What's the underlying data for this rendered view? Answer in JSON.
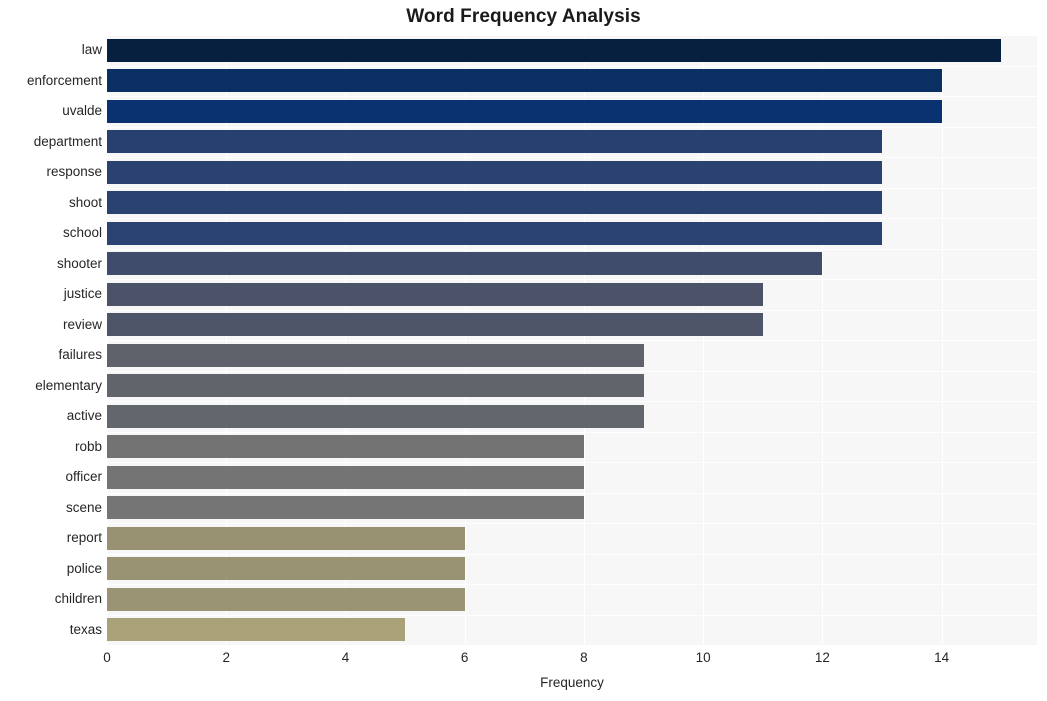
{
  "chart_data": {
    "type": "bar",
    "orientation": "horizontal",
    "title": "Word Frequency Analysis",
    "xlabel": "Frequency",
    "ylabel": "",
    "xlim": [
      0,
      15.6
    ],
    "ylim": [
      0,
      20
    ],
    "xticks": [
      0,
      2,
      4,
      6,
      8,
      10,
      12,
      14
    ],
    "xticklabels": [
      "0",
      "2",
      "4",
      "6",
      "8",
      "10",
      "12",
      "14"
    ],
    "grid": true,
    "grid_color": "#ffffff",
    "plot_background": "#f7f7f7",
    "figure_background": "#ffffff",
    "legend": null,
    "categories": [
      "law",
      "enforcement",
      "uvalde",
      "department",
      "response",
      "shoot",
      "school",
      "shooter",
      "justice",
      "review",
      "failures",
      "elementary",
      "active",
      "robb",
      "officer",
      "scene",
      "report",
      "police",
      "children",
      "texas"
    ],
    "values": [
      15,
      14,
      14,
      13,
      13,
      13,
      13,
      12,
      11,
      11,
      9,
      9,
      9,
      8,
      8,
      8,
      6,
      6,
      6,
      5
    ],
    "bar_colors": [
      "#07203f",
      "#0a2f62",
      "#0a3270",
      "#28406f",
      "#2b4270",
      "#2a4270",
      "#2b4372",
      "#3f4c6b",
      "#4c5369",
      "#4f5569",
      "#5f616b",
      "#62646c",
      "#64666d",
      "#737373",
      "#747474",
      "#757575",
      "#989272",
      "#9a9373",
      "#9b9474",
      "#a9a177"
    ]
  }
}
